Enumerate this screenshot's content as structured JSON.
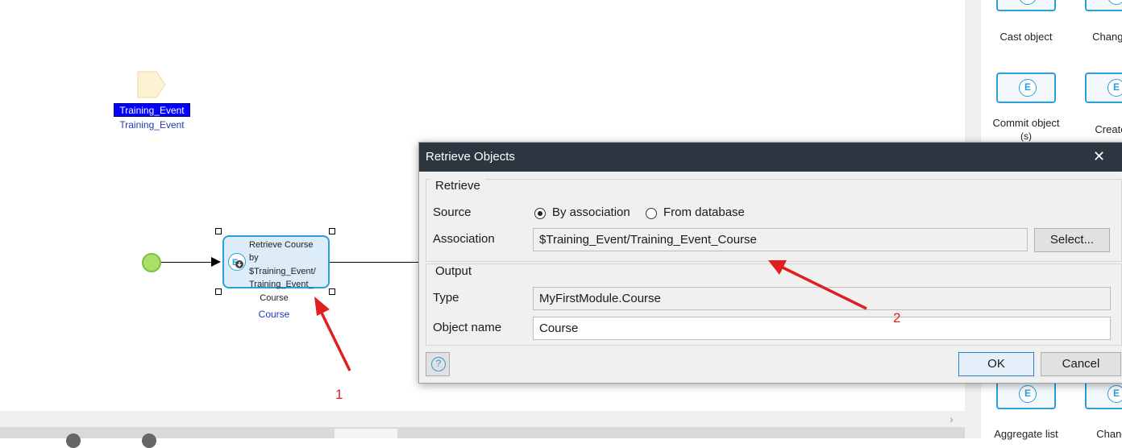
{
  "canvas": {
    "parameter": {
      "caption": "Training_Event",
      "name": "Training_Event"
    },
    "activity": {
      "lines": [
        "Retrieve Course",
        "by",
        "$Training_Event/",
        "Training_Event_"
      ],
      "caption": "Course",
      "name": "Course"
    },
    "annotations": {
      "first": "1",
      "second": "2"
    }
  },
  "toolbox": {
    "items": [
      {
        "label": "Cast object",
        "icon": "cast-object-icon"
      },
      {
        "label": "Change c",
        "icon": "change-object-icon"
      },
      {
        "label": "Commit object",
        "label2": "(s)",
        "icon": "commit-object-icon"
      },
      {
        "label": "Create c",
        "icon": "create-object-icon"
      },
      {
        "label": "Aggregate list",
        "icon": "aggregate-list-icon"
      },
      {
        "label": "Change",
        "icon": "change-list-icon"
      }
    ]
  },
  "dialog": {
    "title": "Retrieve Objects",
    "retrieve_group": "Retrieve",
    "source_label": "Source",
    "source_options": [
      "By association",
      "From database"
    ],
    "source_selected": "By association",
    "association_label": "Association",
    "association_value": "$Training_Event/Training_Event_Course",
    "select_button": "Select...",
    "output_group": "Output",
    "type_label": "Type",
    "type_value": "MyFirstModule.Course",
    "object_name_label": "Object name",
    "object_name_value": "Course",
    "ok_button": "OK",
    "cancel_button": "Cancel",
    "help_symbol": "?",
    "close_symbol": "✕"
  },
  "colors": {
    "accent": "#2a9fdb",
    "annotation": "#e02020",
    "titlebar": "#2d3541",
    "param_blue": "#0000ff"
  }
}
